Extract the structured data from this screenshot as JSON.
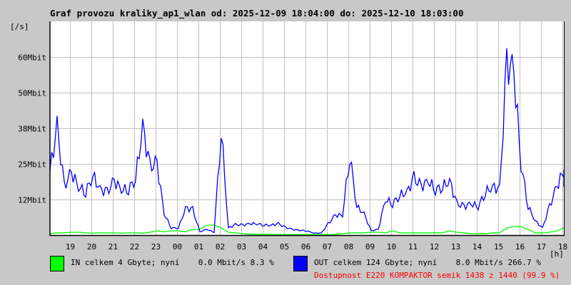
{
  "chart_data": {
    "type": "line",
    "title": "Graf provozu kraliky_ap1_wlan od: 2025-12-09 18:04:00 do: 2025-12-10 18:03:00",
    "ylabel": "[/s]",
    "xlabel": "[h]",
    "ylim": [
      0,
      75
    ],
    "xlim_hours": [
      0,
      24
    ],
    "grid": true,
    "y_ticks": [
      {
        "value": 12.5,
        "label": "12Mbit"
      },
      {
        "value": 25,
        "label": "25Mbit"
      },
      {
        "value": 37.5,
        "label": "38Mbit"
      },
      {
        "value": 50,
        "label": "50Mbit"
      },
      {
        "value": 62.5,
        "label": "60Mbit"
      }
    ],
    "x_ticks": [
      "19",
      "20",
      "21",
      "22",
      "23",
      "00",
      "01",
      "02",
      "03",
      "04",
      "05",
      "06",
      "07",
      "08",
      "09",
      "10",
      "11",
      "12",
      "13",
      "14",
      "15",
      "16",
      "17",
      "18"
    ],
    "x_step_minutes": 20,
    "series": [
      {
        "name": "IN",
        "color": "#00ff00",
        "values": [
          0.5,
          0.8,
          0.8,
          1,
          1,
          0.8,
          0.7,
          0.8,
          0.8,
          0.8,
          0.7,
          0.8,
          0.8,
          0.7,
          1,
          1.5,
          1.2,
          1.5,
          1.5,
          1.2,
          2,
          2,
          3.5,
          3.5,
          2.5,
          1,
          0.8,
          0.5,
          0.3,
          0.3,
          0.3,
          0.3,
          0.2,
          0.2,
          0.2,
          0.2,
          0.2,
          0.2,
          0.2,
          0.2,
          0.3,
          0.5,
          0.8,
          0.8,
          0.8,
          1,
          1,
          0.8,
          1.5,
          0.8,
          0.8,
          0.8,
          0.8,
          0.8,
          0.8,
          0.8,
          1.5,
          1,
          0.8,
          0.5,
          0.5,
          0.5,
          0.8,
          0.8,
          2.5,
          3,
          3,
          2,
          0.8,
          0.8,
          1,
          1.5,
          2.5
        ]
      },
      {
        "name": "OUT",
        "color": "#0000ff",
        "values": [
          22.5,
          38,
          17,
          22,
          17,
          15,
          21,
          16,
          15,
          19,
          16,
          16,
          20,
          38,
          24,
          25,
          7.5,
          2.5,
          2.5,
          9.5,
          9,
          1.2,
          2,
          1,
          37,
          2.5,
          3.7,
          3.5,
          4,
          4,
          3.5,
          3.5,
          4,
          2.7,
          2,
          1.7,
          1.5,
          0.7,
          0.7,
          4,
          7,
          7,
          28,
          10,
          7.5,
          1.5,
          2,
          12.5,
          11,
          14,
          15,
          20,
          17,
          19,
          16,
          17,
          19,
          11,
          10,
          11,
          10,
          15,
          17,
          16,
          60,
          57.5,
          25,
          10,
          5,
          2.5,
          10,
          17,
          22.5,
          19
        ]
      }
    ]
  },
  "legend": {
    "in_text": "IN celkem 4 Gbyte; nyní    0.0 Mbit/s 8.3 %",
    "out_text": "OUT celkem 124 Gbyte; nyní    8.0 Mbit/s 266.7 %",
    "availability_text": "Dostupnost E220 KOMPAKTOR semik 1438 z 1440 (99.9 %)",
    "in_color": "#00ff00",
    "out_color": "#0000ff",
    "availability_color": "#ff0000"
  }
}
